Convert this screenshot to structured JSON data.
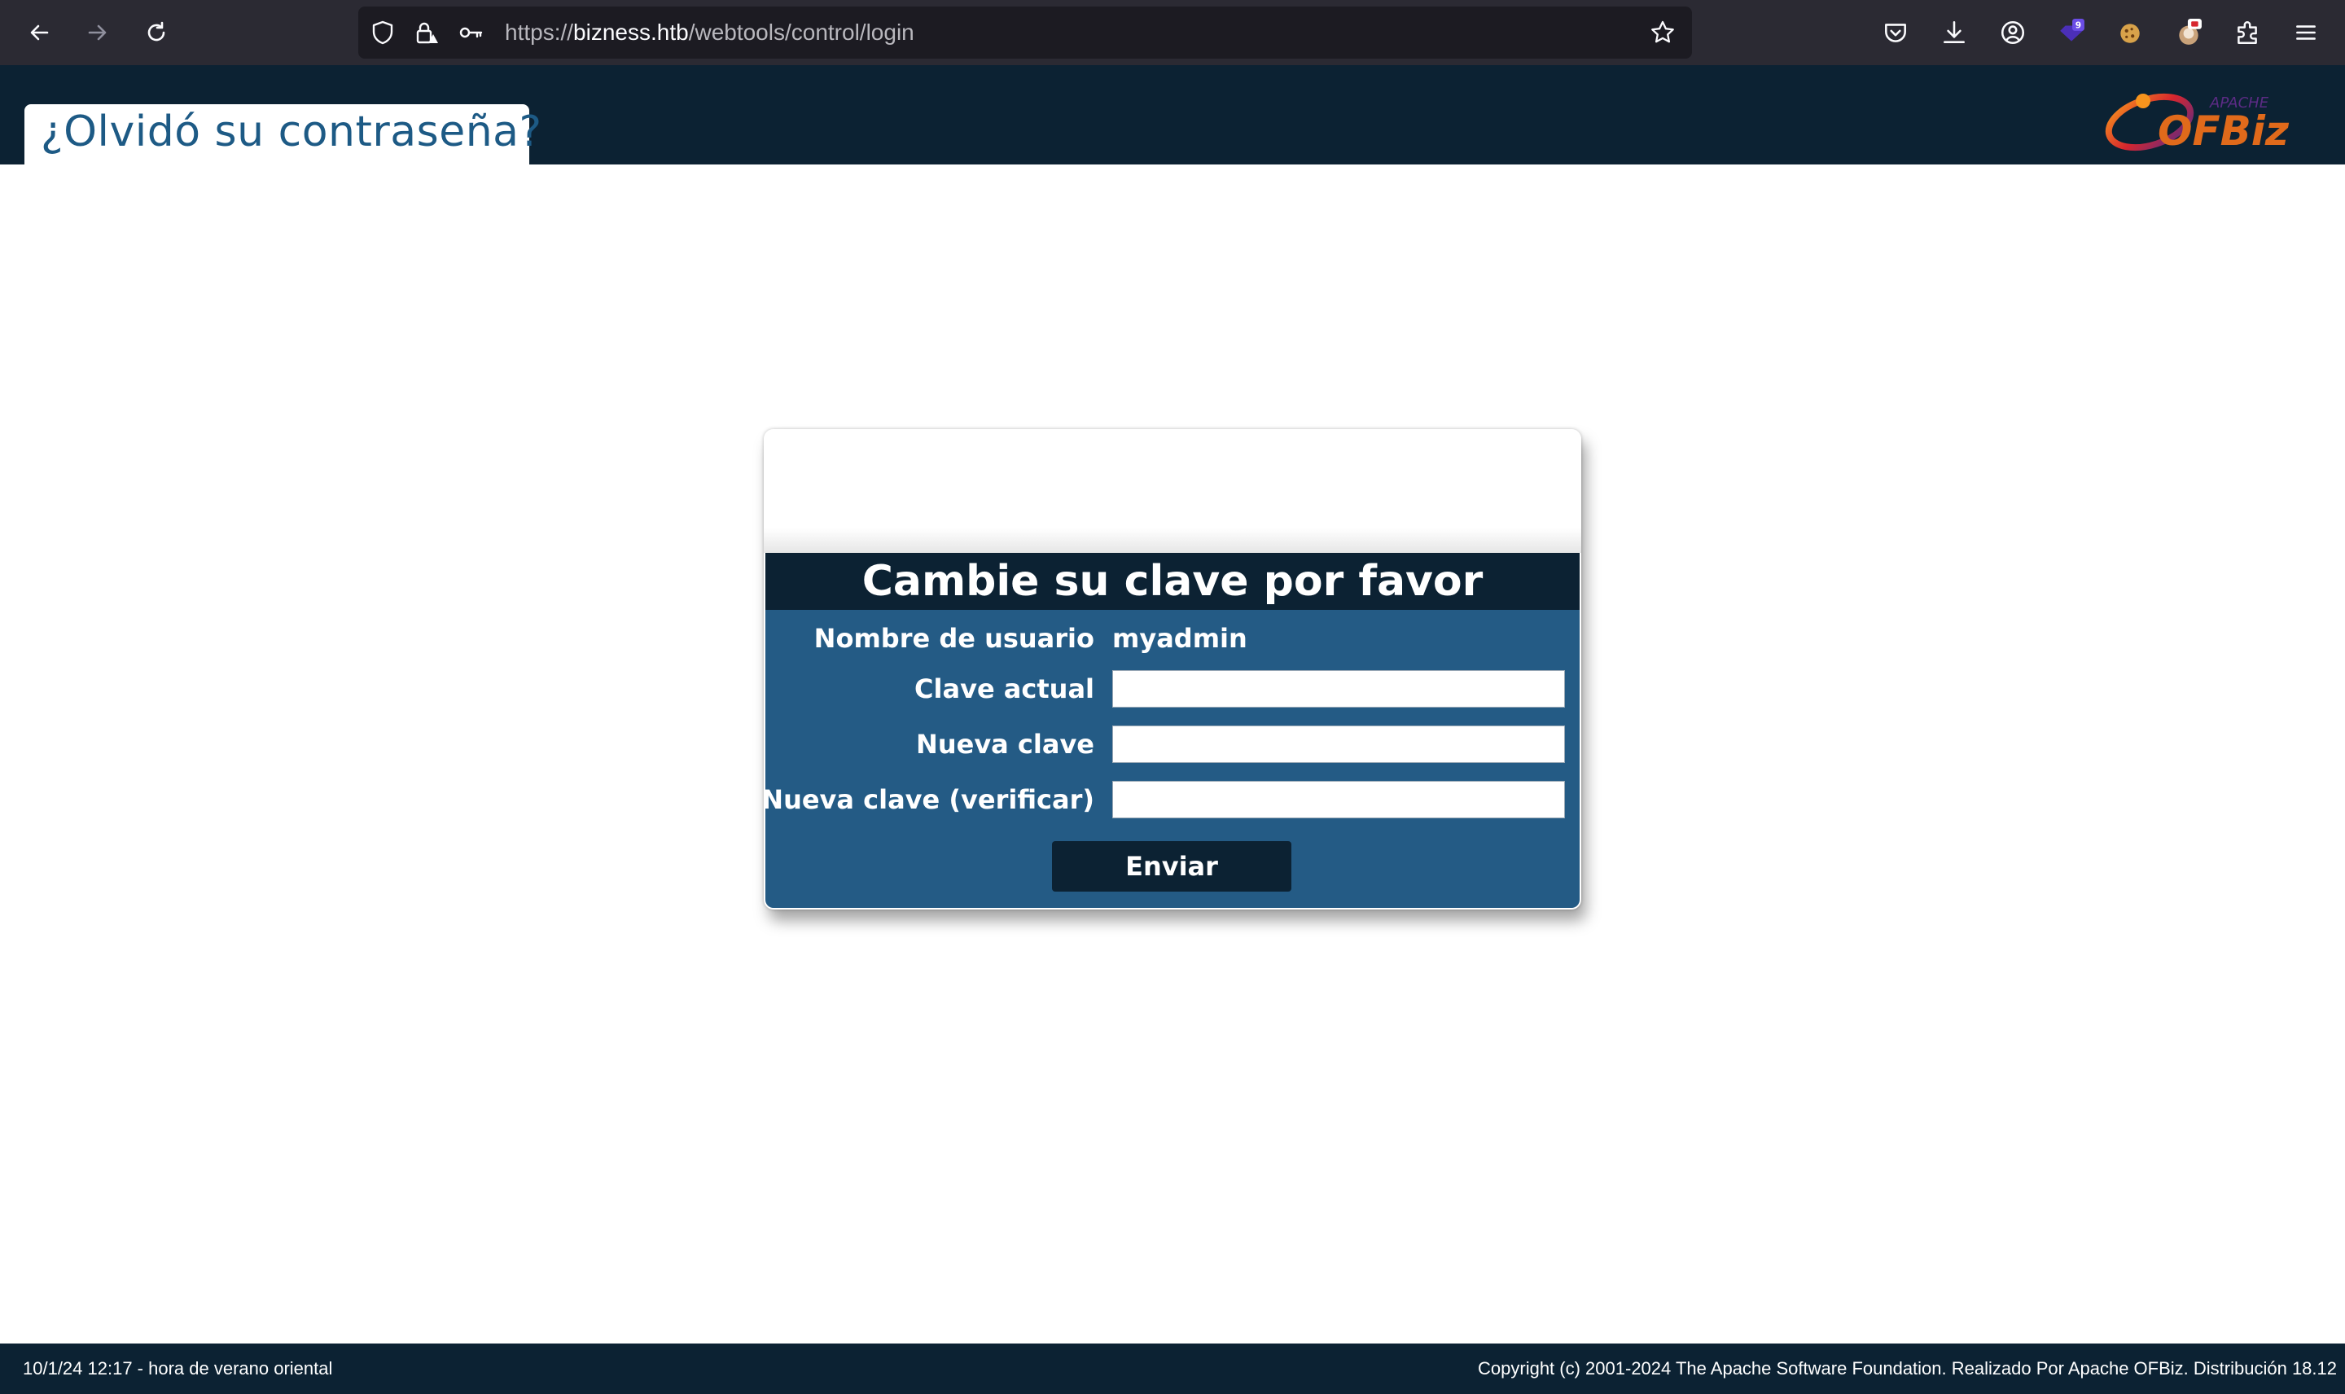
{
  "browser": {
    "url_scheme": "https://",
    "url_host": "bizness.htb",
    "url_path": "/webtools/control/login",
    "icons": [
      "back-icon",
      "forward-icon",
      "reload-icon",
      "shield-icon",
      "lock-warning-icon",
      "key-icon",
      "star-icon",
      "pocket-icon",
      "download-icon",
      "account-icon",
      "extension-badge-icon",
      "cookie-icon",
      "extension-icon",
      "puzzle-icon",
      "menu-icon"
    ],
    "extension_badge": "9"
  },
  "header": {
    "title": "¿Olvidó su contraseña?",
    "logo_small_text": "APACHE",
    "logo_text": "OFBiz",
    "background": "#0c2233"
  },
  "form": {
    "title": "Cambie su clave por favor",
    "username_label": "Nombre de usuario",
    "username_value": "myadmin",
    "current_password_label": "Clave actual",
    "new_password_label": "Nueva clave",
    "verify_password_label": "Nueva clave (verificar)",
    "submit_label": "Enviar",
    "body_color": "#245b85"
  },
  "footer": {
    "left_text": "10/1/24 12:17 - hora de verano oriental",
    "right_text": "Copyright (c) 2001-2024 The Apache Software Foundation. Realizado Por Apache OFBiz. Distribución 18.12"
  }
}
